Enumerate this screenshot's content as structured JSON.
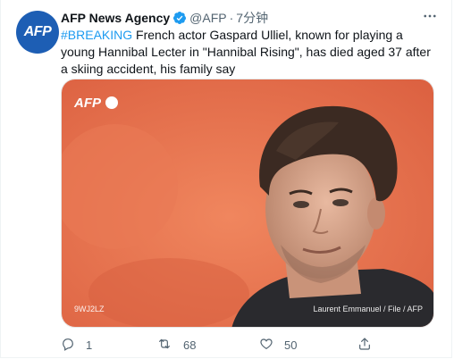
{
  "tweet": {
    "avatar_text": "AFP",
    "author_name": "AFP News Agency",
    "handle": "@AFP",
    "separator": "·",
    "time": "7分钟",
    "hashtag": "#BREAKING",
    "text": " French actor Gaspard Ulliel, known for playing a young Hannibal Lecter in \"Hannibal Rising\", has died aged 37 after a skiing accident, his family say"
  },
  "media": {
    "logo_text": "AFP",
    "image_id": "9WJ2LZ",
    "credit": "Laurent Emmanuel / File / AFP",
    "colors": {
      "background": "#e8734f",
      "hair": "#3b2a22",
      "skin": "#d9a58a",
      "shirt": "#2a2a2e"
    }
  },
  "actions": {
    "reply_count": "1",
    "retweet_count": "68",
    "like_count": "50"
  },
  "colors": {
    "accent": "#1d9bf0",
    "muted": "#536471",
    "brand": "#1d5eb4"
  }
}
